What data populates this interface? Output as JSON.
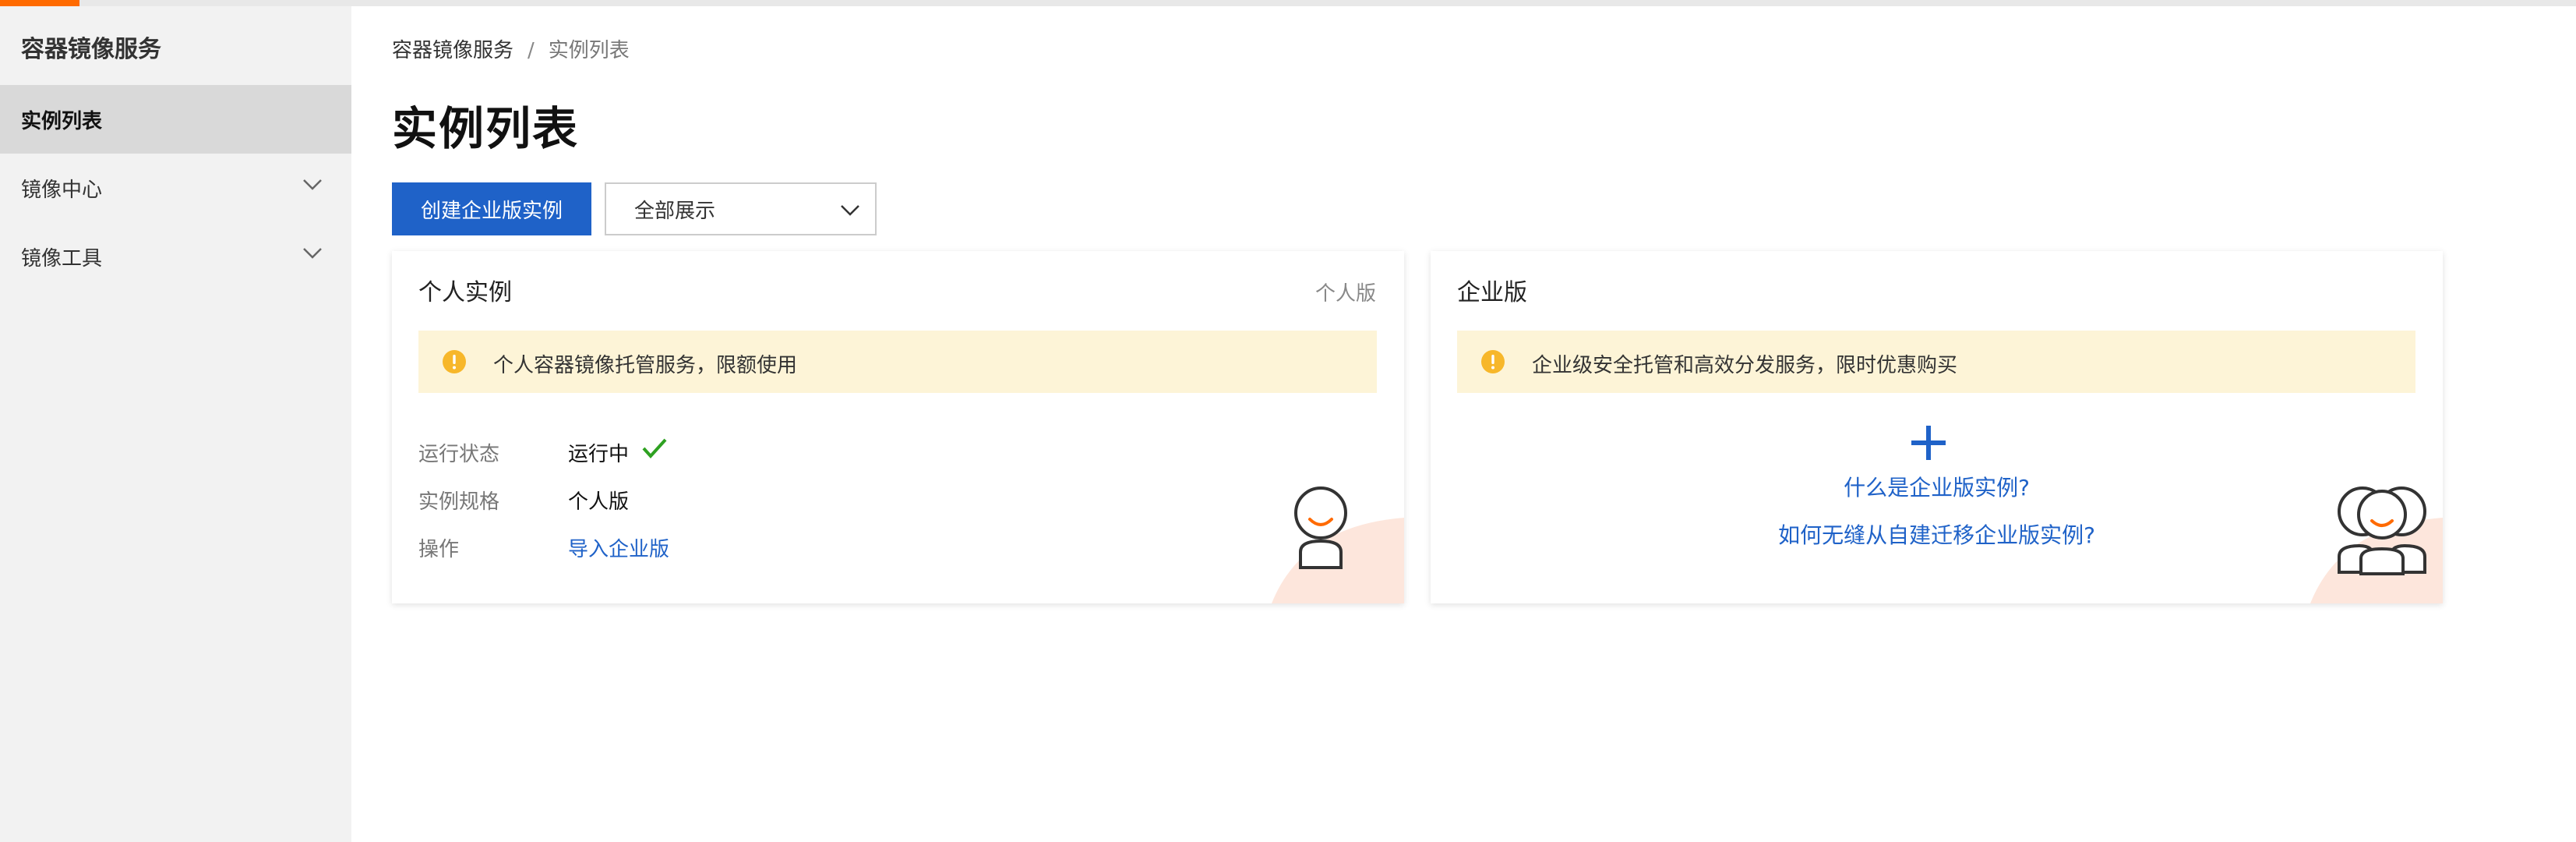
{
  "sidebar": {
    "title": "容器镜像服务",
    "items": [
      {
        "label": "实例列表",
        "active": true
      },
      {
        "label": "镜像中心",
        "active": false,
        "icon": "chevron-down-icon"
      },
      {
        "label": "镜像工具",
        "active": false,
        "icon": "chevron-down-icon"
      }
    ]
  },
  "breadcrumb": {
    "root": "容器镜像服务",
    "separator": "/",
    "current": "实例列表"
  },
  "page": {
    "title": "实例列表"
  },
  "toolbar": {
    "create_button": "创建企业版实例",
    "filter_select": "全部展示"
  },
  "personal_card": {
    "title": "个人实例",
    "tag": "个人版",
    "alert": "个人容器镜像托管服务，限额使用",
    "rows": [
      {
        "label": "运行状态",
        "value": "运行中",
        "icon": "check-icon"
      },
      {
        "label": "实例规格",
        "value": "个人版"
      },
      {
        "label": "操作",
        "value": "导入企业版"
      }
    ]
  },
  "enterprise_card": {
    "title": "企业版",
    "alert": "企业级安全托管和高效分发服务，限时优惠购买",
    "links": [
      "什么是企业版实例?",
      "如何无缝从自建迁移企业版实例?"
    ]
  },
  "colors": {
    "accent": "#ff6a00",
    "primary": "#1f62c8",
    "alert_bg": "#fdf4d7",
    "warning": "#f7b72a",
    "success": "#2ea121"
  }
}
